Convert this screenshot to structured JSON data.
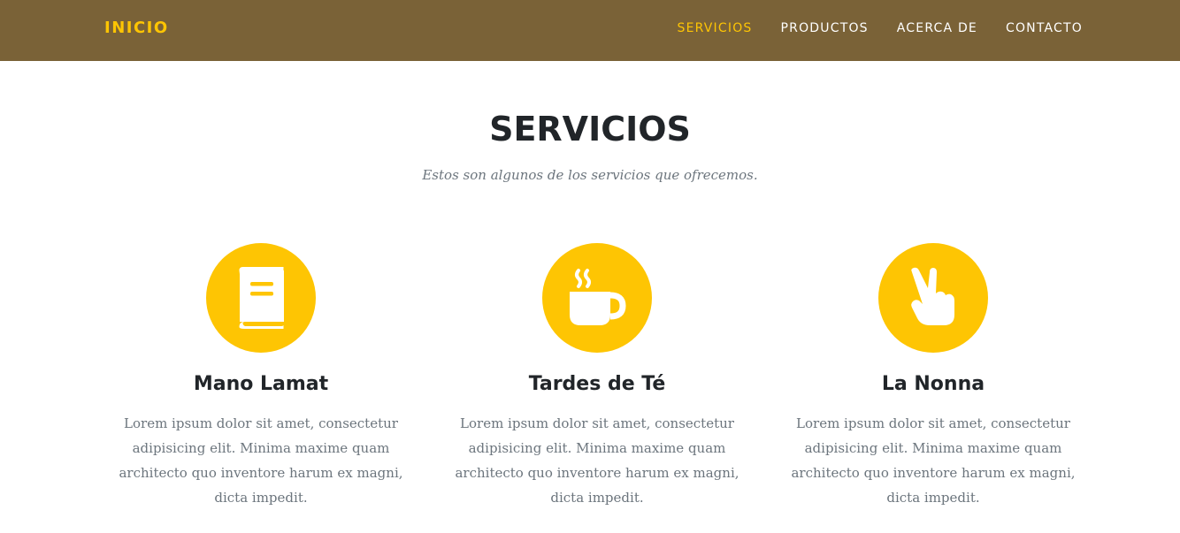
{
  "nav": {
    "brand": "INICIO",
    "links": [
      {
        "label": "SERVICIOS",
        "active": true
      },
      {
        "label": "PRODUCTOS",
        "active": false
      },
      {
        "label": "ACERCA DE",
        "active": false
      },
      {
        "label": "CONTACTO",
        "active": false
      }
    ]
  },
  "section": {
    "title": "SERVICIOS",
    "subtitle": "Estos son algunos de los servicios que ofrecemos."
  },
  "services": [
    {
      "icon": "book-icon",
      "name": "Mano Lamat",
      "description": "Lorem ipsum dolor sit amet, consectetur adipisicing elit. Minima maxime quam architecto quo inventore harum ex magni, dicta impedit."
    },
    {
      "icon": "coffee-cup-icon",
      "name": "Tardes de Té",
      "description": "Lorem ipsum dolor sit amet, consectetur adipisicing elit. Minima maxime quam architecto quo inventore harum ex magni, dicta impedit."
    },
    {
      "icon": "hand-peace-icon",
      "name": "La Nonna",
      "description": "Lorem ipsum dolor sit amet, consectetur adipisicing elit. Minima maxime quam architecto quo inventore harum ex magni, dicta impedit."
    }
  ],
  "colors": {
    "navbar": "#7a6237",
    "accent": "#fec503",
    "heading": "#212529",
    "muted": "#6c757d"
  }
}
